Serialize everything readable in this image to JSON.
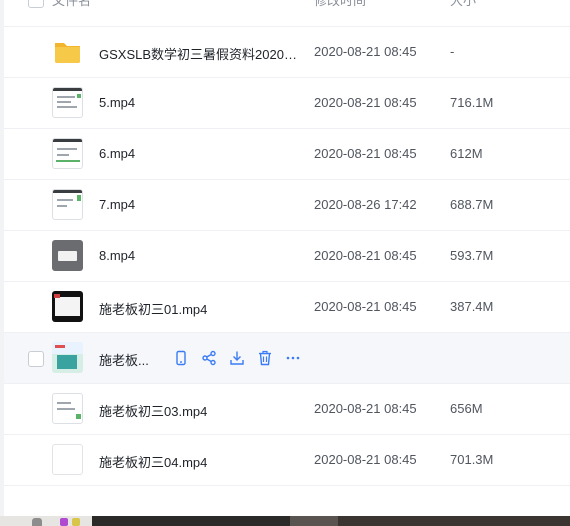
{
  "header": {
    "name_label": "文件名",
    "time_label": "修改时间",
    "size_label": "大小"
  },
  "rows": [
    {
      "name": "GSXSLB数学初三暑假资料2020-...",
      "time": "2020-08-21 08:45",
      "size": "-",
      "thumb": "folder"
    },
    {
      "name": "5.mp4",
      "time": "2020-08-21 08:45",
      "size": "716.1M",
      "thumb": "screenshot"
    },
    {
      "name": "6.mp4",
      "time": "2020-08-21 08:45",
      "size": "612M",
      "thumb": "screenshot"
    },
    {
      "name": "7.mp4",
      "time": "2020-08-26 17:42",
      "size": "688.7M",
      "thumb": "screenshot"
    },
    {
      "name": "8.mp4",
      "time": "2020-08-21 08:45",
      "size": "593.7M",
      "thumb": "gray"
    },
    {
      "name": "施老板初三01.mp4",
      "time": "2020-08-21 08:45",
      "size": "387.4M",
      "thumb": "dark"
    },
    {
      "name": "施老板...",
      "time": "",
      "size": "",
      "thumb": "color",
      "hovered": true
    },
    {
      "name": "施老板初三03.mp4",
      "time": "2020-08-21 08:45",
      "size": "656M",
      "thumb": "screenshot"
    },
    {
      "name": "施老板初三04.mp4",
      "time": "2020-08-21 08:45",
      "size": "701.3M",
      "thumb": "blank"
    }
  ],
  "hover_actions": [
    "phone-icon",
    "share-icon",
    "download-icon",
    "delete-icon",
    "more-icon"
  ],
  "colors": {
    "accent": "#3b7cf5",
    "folder": "#f7c948",
    "hover_bg": "#f5f7fb",
    "divider": "#eef0f3"
  }
}
